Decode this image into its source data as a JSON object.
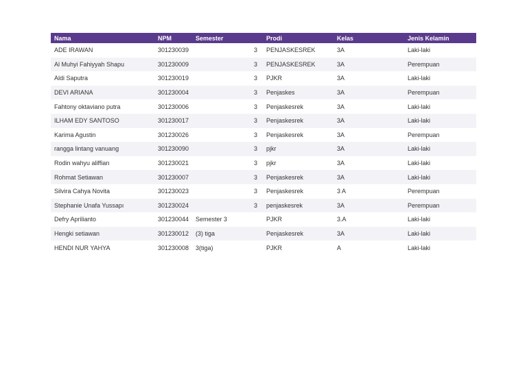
{
  "table": {
    "headers": [
      "Nama",
      "NPM",
      "Semester",
      "Prodi",
      "Kelas",
      "Jenis Kelamin"
    ],
    "rows": [
      {
        "nama": "ADE IRAWAN",
        "npm": "301230039",
        "semester": "3",
        "prodi": "PENJASKESREK",
        "kelas": "3A",
        "jk": "Laki-laki"
      },
      {
        "nama": "Al Muhyi Fahiyyah Shapu",
        "npm": "301230009",
        "semester": "3",
        "prodi": "PENJASKESREK",
        "kelas": "3A",
        "jk": "Perempuan"
      },
      {
        "nama": "Aldi Saputra",
        "npm": "301230019",
        "semester": "3",
        "prodi": "PJKR",
        "kelas": "3A",
        "jk": "Laki-laki"
      },
      {
        "nama": "DEVI ARIANA",
        "npm": "301230004",
        "semester": "3",
        "prodi": "Penjaskes",
        "kelas": "3A",
        "jk": "Perempuan"
      },
      {
        "nama": "Fahtony oktaviano putra",
        "npm": "301230006",
        "semester": "3",
        "prodi": "Penjaskesrek",
        "kelas": "3A",
        "jk": "Laki-laki"
      },
      {
        "nama": "ILHAM EDY SANTOSO",
        "npm": "301230017",
        "semester": "3",
        "prodi": "Penjaskesrek",
        "kelas": "3A",
        "jk": "Laki-laki"
      },
      {
        "nama": "Karima Agustin",
        "npm": "301230026",
        "semester": "3",
        "prodi": "Penjaskesrek",
        "kelas": "3A",
        "jk": "Perempuan"
      },
      {
        "nama": "rangga lintang vanuang",
        "npm": "301230090",
        "semester": "3",
        "prodi": "pjkr",
        "kelas": "3A",
        "jk": "Laki-laki"
      },
      {
        "nama": "Rodin wahyu aliffian",
        "npm": "301230021",
        "semester": "3",
        "prodi": "pjkr",
        "kelas": "3A",
        "jk": "Laki-laki"
      },
      {
        "nama": "Rohmat Setiawan",
        "npm": "301230007",
        "semester": "3",
        "prodi": "Penjaskesrek",
        "kelas": "3A",
        "jk": "Laki-laki"
      },
      {
        "nama": "Silvira Cahya Novita",
        "npm": "301230023",
        "semester": "3",
        "prodi": "Penjaskesrek",
        "kelas": "3 A",
        "jk": "Perempuan"
      },
      {
        "nama": "Stephanie Unafa Yussapı",
        "npm": "301230024",
        "semester": "3",
        "prodi": "penjaskesrek",
        "kelas": "3A",
        "jk": "Perempuan"
      },
      {
        "nama": "Defry Aprilianto",
        "npm": "301230044",
        "semester": "Semester 3",
        "prodi": "PJKR",
        "kelas": "3.A",
        "jk": "Laki-laki"
      },
      {
        "nama": "Hengki setiawan",
        "npm": "301230012",
        "semester": "(3) tiga",
        "prodi": "Penjaskesrek",
        "kelas": "3A",
        "jk": "Laki-laki"
      },
      {
        "nama": "HENDI NUR YAHYA",
        "npm": "301230008",
        "semester": "3(tiga)",
        "prodi": "PJKR",
        "kelas": "A",
        "jk": "Laki-laki"
      }
    ]
  },
  "colors": {
    "header_bg": "#5a3a8c",
    "header_text": "#ffffff",
    "stripe": "#f3f3f7"
  }
}
